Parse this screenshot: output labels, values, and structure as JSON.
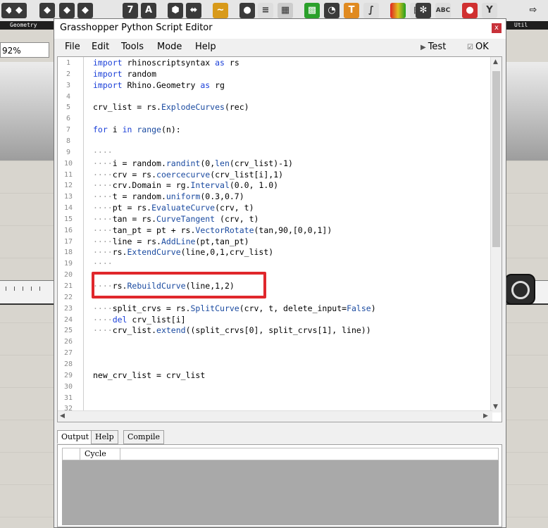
{
  "background": {
    "tabs": [
      "Geometry",
      "Util"
    ],
    "zoom_value": "92%"
  },
  "window": {
    "title": "Grasshopper Python Script Editor",
    "close_label": "x"
  },
  "menu": {
    "items": [
      "File",
      "Edit",
      "Tools",
      "Mode",
      "Help"
    ],
    "test_label": "Test",
    "ok_label": "OK"
  },
  "code": {
    "line_numbers": [
      "1",
      "2",
      "3",
      "4",
      "5",
      "6",
      "7",
      "8",
      "9",
      "10",
      "11",
      "12",
      "13",
      "14",
      "15",
      "16",
      "17",
      "18",
      "19",
      "20",
      "21",
      "22",
      "23",
      "24",
      "25",
      "26",
      "27",
      "28",
      "29",
      "30",
      "31",
      "32"
    ],
    "lines": [
      "import rhinoscriptsyntax as rs",
      "import random",
      "import Rhino.Geometry as rg",
      "",
      "crv_list = rs.ExplodeCurves(rec)",
      "",
      "for i in range(n):",
      "",
      "····",
      "····i = random.randint(0,len(crv_list)-1)",
      "····crv = rs.coercecurve(crv_list[i],1)",
      "····crv.Domain = rg.Interval(0.0, 1.0)",
      "····t = random.uniform(0.3,0.7)",
      "····pt = rs.EvaluateCurve(crv, t)",
      "····tan = rs.CurveTangent (crv, t)",
      "····tan_pt = pt + rs.VectorRotate(tan,90,[0,0,1])",
      "····line = rs.AddLine(pt,tan_pt)",
      "····rs.ExtendCurve(line,0,1,crv_list)",
      "····",
      "",
      "····rs.RebuildCurve(line,1,2)",
      "",
      "····split_crvs = rs.SplitCurve(crv, t, delete_input=False)",
      "····del crv_list[i]",
      "····crv_list.extend((split_crvs[0], split_crvs[1], line))",
      "",
      "",
      "",
      "new_crv_list = crv_list",
      "",
      "",
      ""
    ]
  },
  "output": {
    "tabs": [
      "Output",
      "Help",
      "Compile"
    ],
    "column_header": "Cycle"
  },
  "colors": {
    "keyword": "#1a3fd8",
    "highlight_box": "#e0272c",
    "close_button": "#c8323a"
  }
}
